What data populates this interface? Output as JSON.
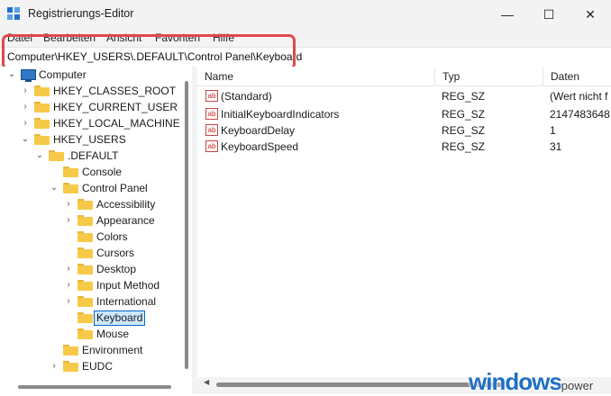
{
  "window": {
    "title": "Registrierungs-Editor",
    "buttons": {
      "minimize": "—",
      "maximize": "☐",
      "close": "✕"
    }
  },
  "menu": [
    "Datei",
    "Bearbeiten",
    "Ansicht",
    "Favoriten",
    "Hilfe"
  ],
  "address": "Computer\\HKEY_USERS\\.DEFAULT\\Control Panel\\Keyboard",
  "tree": {
    "root": "Computer",
    "hives": [
      "HKEY_CLASSES_ROOT",
      "HKEY_CURRENT_USER",
      "HKEY_LOCAL_MACHINE",
      "HKEY_USERS"
    ],
    "default_key": ".DEFAULT",
    "default_children": [
      "Console",
      "Control Panel"
    ],
    "control_panel_children": [
      "Accessibility",
      "Appearance",
      "Colors",
      "Cursors",
      "Desktop",
      "Input Method",
      "International",
      "Keyboard",
      "Mouse"
    ],
    "selected": "Keyboard",
    "after": [
      "Environment",
      "EUDC"
    ]
  },
  "columns": {
    "name": "Name",
    "type": "Typ",
    "data": "Daten"
  },
  "values": [
    {
      "name": "(Standard)",
      "type": "REG_SZ",
      "data": "(Wert nicht f"
    },
    {
      "name": "InitialKeyboardIndicators",
      "type": "REG_SZ",
      "data": "2147483648"
    },
    {
      "name": "KeyboardDelay",
      "type": "REG_SZ",
      "data": "1"
    },
    {
      "name": "KeyboardSpeed",
      "type": "REG_SZ",
      "data": "31"
    }
  ],
  "value_icon_text": "ab",
  "watermark": {
    "main": "windows",
    "suffix": "power"
  }
}
